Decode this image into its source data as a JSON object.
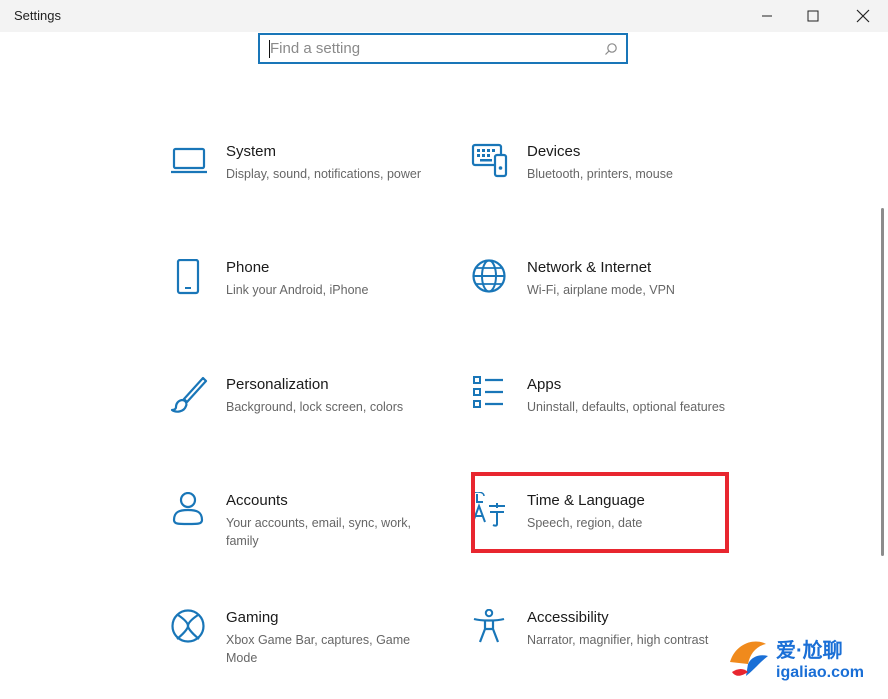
{
  "window": {
    "title": "Settings",
    "controls": [
      "minimize",
      "maximize",
      "close"
    ]
  },
  "search": {
    "placeholder": "Find a setting",
    "value": ""
  },
  "categories": [
    {
      "id": "system",
      "title": "System",
      "description": "Display, sound, notifications, power",
      "icon": "laptop-icon"
    },
    {
      "id": "devices",
      "title": "Devices",
      "description": "Bluetooth, printers, mouse",
      "icon": "keyboard-icon"
    },
    {
      "id": "phone",
      "title": "Phone",
      "description": "Link your Android, iPhone",
      "icon": "phone-icon"
    },
    {
      "id": "network",
      "title": "Network & Internet",
      "description": "Wi-Fi, airplane mode, VPN",
      "icon": "globe-icon"
    },
    {
      "id": "personalization",
      "title": "Personalization",
      "description": "Background, lock screen, colors",
      "icon": "brush-icon"
    },
    {
      "id": "apps",
      "title": "Apps",
      "description": "Uninstall, defaults, optional features",
      "icon": "apps-list-icon"
    },
    {
      "id": "accounts",
      "title": "Accounts",
      "description": "Your accounts, email, sync, work, family",
      "icon": "person-icon"
    },
    {
      "id": "time-language",
      "title": "Time & Language",
      "description": "Speech, region, date",
      "icon": "language-icon"
    },
    {
      "id": "gaming",
      "title": "Gaming",
      "description": "Xbox Game Bar, captures, Game Mode",
      "icon": "xbox-icon"
    },
    {
      "id": "accessibility",
      "title": "Accessibility",
      "description": "Narrator, magnifier, high contrast",
      "icon": "accessibility-icon"
    }
  ],
  "highlight": {
    "target": "time-language",
    "color": "#e8262f"
  },
  "accent_color": "#1976b8",
  "watermark": {
    "text": "爱·尬聊",
    "url": "igaliao.com"
  }
}
